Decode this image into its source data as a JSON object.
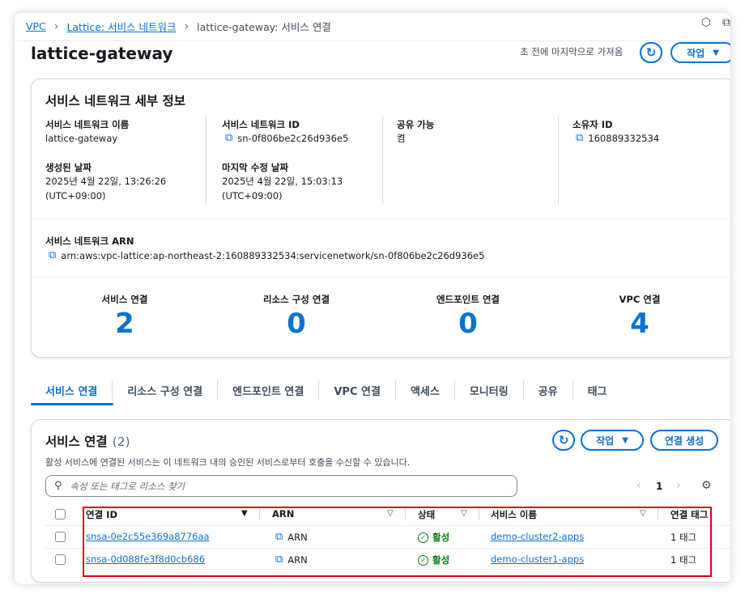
{
  "breadcrumb": [
    "VPC",
    "Lattice: 서비스 네트워크",
    "lattice-gateway: 서비스 연결"
  ],
  "page_title": "lattice-gateway",
  "last_fetched": "초 전에 마지막으로 가져옴",
  "actions_label": "작업",
  "details": {
    "heading": "서비스 네트워크 세부 정보",
    "name_label": "서비스 네트워크 이름",
    "name_value": "lattice-gateway",
    "id_label": "서비스 네트워크 ID",
    "id_value": "sn-0f806be2c26d936e5",
    "shareable_label": "공유 가능",
    "shareable_value": "켬",
    "owner_label": "소유자 ID",
    "owner_value": "160889332534",
    "created_label": "생성된 날짜",
    "created_value": "2025년 4월 22일, 13:26:26",
    "created_tz": "(UTC+09:00)",
    "modified_label": "마지막 수정 날짜",
    "modified_value": "2025년 4월 22일, 15:03:13",
    "modified_tz": "(UTC+09:00)",
    "arn_label": "서비스 네트워크 ARN",
    "arn_value": "arn:aws:vpc-lattice:ap-northeast-2:160889332534:servicenetwork/sn-0f806be2c26d936e5"
  },
  "stats": [
    {
      "label": "서비스 연결",
      "value": "2"
    },
    {
      "label": "리소스 구성 연결",
      "value": "0"
    },
    {
      "label": "엔드포인트 연결",
      "value": "0"
    },
    {
      "label": "VPC 연결",
      "value": "4"
    }
  ],
  "tabs": [
    "서비스 연결",
    "리소스 구성 연결",
    "엔드포인트 연결",
    "VPC 연결",
    "액세스",
    "모니터링",
    "공유",
    "태그"
  ],
  "table": {
    "heading": "서비스 연결",
    "count": "(2)",
    "description": "활성 서비스에 연결된 서비스는 이 네트워크 내의 승인된 서비스로부터 호출을 수신할 수 있습니다.",
    "actions_label": "작업",
    "create_label": "연결 생성",
    "search_placeholder": "속성 또는 태그로 리소스 찾기",
    "page": "1",
    "columns": [
      "연결 ID",
      "ARN",
      "상태",
      "서비스 이름",
      "연결 태그"
    ],
    "rows": [
      {
        "id": "snsa-0e2c55e369a8776aa",
        "arn": "ARN",
        "status": "활성",
        "service": "demo-cluster2-apps",
        "tags": "1 태그"
      },
      {
        "id": "snsa-0d088fe3f8d0cb686",
        "arn": "ARN",
        "status": "활성",
        "service": "demo-cluster1-apps",
        "tags": "1 태그"
      }
    ]
  },
  "colors": {
    "accent": "#0972d3",
    "success": "#037f0c",
    "highlight": "#e0000e"
  }
}
